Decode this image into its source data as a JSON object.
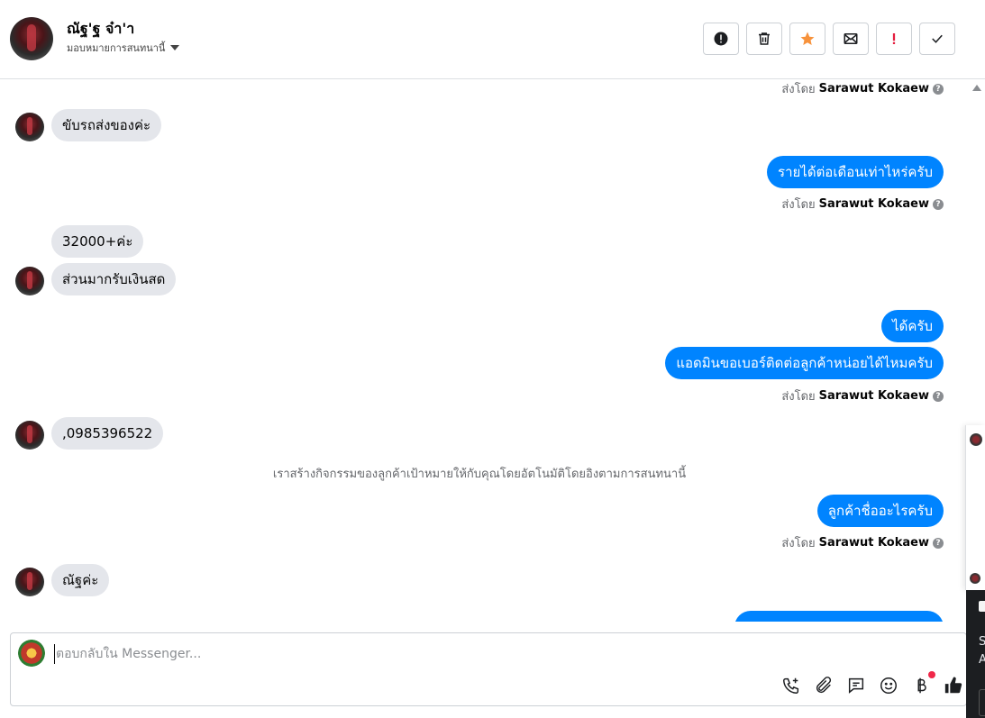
{
  "header": {
    "contact_name": "ณัฐ'ฐ จ๋า'า",
    "assign_label": "มอบหมายการสนทนานี้",
    "actions": [
      {
        "name": "mark-spam-button",
        "icon": "alert-circle-icon"
      },
      {
        "name": "delete-button",
        "icon": "trash-icon"
      },
      {
        "name": "star-button",
        "icon": "star-icon",
        "color": "#f7923b"
      },
      {
        "name": "mark-unread-button",
        "icon": "envelope-icon"
      },
      {
        "name": "follow-up-button",
        "icon": "exclamation-icon",
        "color": "#e41e3f"
      },
      {
        "name": "mark-done-button",
        "icon": "check-icon"
      }
    ]
  },
  "conversation": {
    "sent_by_prefix": "ส่งโดย",
    "sent_by_name": "Sarawut Kokaew",
    "messages": [
      {
        "dir": "in",
        "text": "ขับรถส่งของค่ะ"
      },
      {
        "dir": "out",
        "text": "รายได้ต่อเดือนเท่าไหร่ครับ"
      },
      {
        "dir": "in",
        "text": "32000+ค่ะ"
      },
      {
        "dir": "in",
        "text": "ส่วนมากรับเงินสด"
      },
      {
        "dir": "out",
        "text": "ได้ครับ"
      },
      {
        "dir": "out",
        "text": "แอดมินขอเบอร์ติดต่อลูกค้าหน่อยได้ไหมครับ"
      },
      {
        "dir": "in",
        "text": ",0985396522"
      },
      {
        "dir": "system",
        "text": "เราสร้างกิจกรรมของลูกค้าเป้าหมายให้กับคุณโดยอัตโนมัติโดยอิงตามการสนทนานี้"
      },
      {
        "dir": "out",
        "text": "ลูกค้าชื่ออะไรครับ"
      },
      {
        "dir": "in",
        "text": "ณัฐค่ะ"
      }
    ]
  },
  "composer": {
    "placeholder": "ตอบกลับใน Messenger...",
    "tools": [
      "phone-plus-icon",
      "paperclip-icon",
      "chat-bubble-icon",
      "smiley-icon",
      "baht-icon",
      "thumbs-up-icon"
    ]
  },
  "colors": {
    "outgoing_bubble": "#0084ff",
    "incoming_bubble": "#e4e6eb",
    "secondary_text": "#65676b"
  }
}
